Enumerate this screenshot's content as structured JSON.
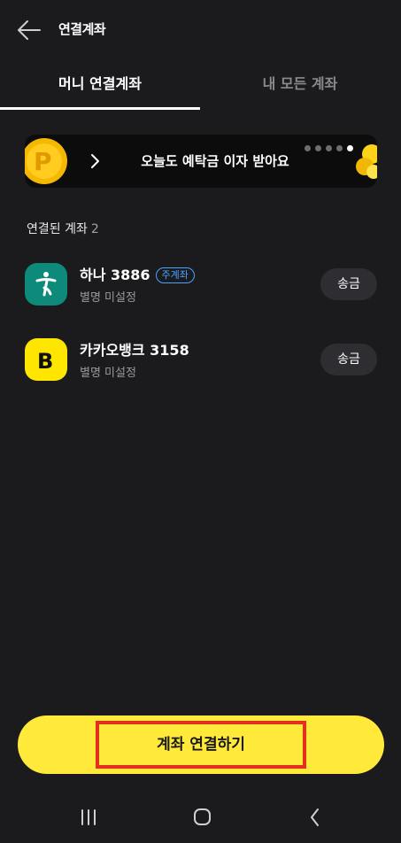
{
  "header": {
    "title": "연결계좌",
    "back_icon": "arrow-left-icon"
  },
  "tabs": [
    {
      "label": "머니 연결계좌",
      "active": true
    },
    {
      "label": "내 모든 계좌",
      "active": false
    }
  ],
  "banner": {
    "text": "오늘도 예탁금 이자 받아요",
    "dots_total": 5,
    "dots_active_index": 4,
    "coin_letter": "P"
  },
  "section": {
    "label": "연결된 계좌",
    "count": "2"
  },
  "accounts": [
    {
      "name": "하나 3886",
      "badge": "주계좌",
      "sub": "별명 미설정",
      "send_label": "송금",
      "logo_color": "#0e8a7b"
    },
    {
      "name": "카카오뱅크 3158",
      "badge": "",
      "sub": "별명 미설정",
      "send_label": "송금",
      "logo_color": "#ffe600",
      "logo_letter": "B"
    }
  ],
  "connect_button": {
    "label": "계좌 연결하기"
  },
  "colors": {
    "background": "#1b1b1d",
    "accent_yellow": "#ffe93a",
    "highlight_red": "#e53020",
    "badge_blue": "#4aa3ff"
  }
}
